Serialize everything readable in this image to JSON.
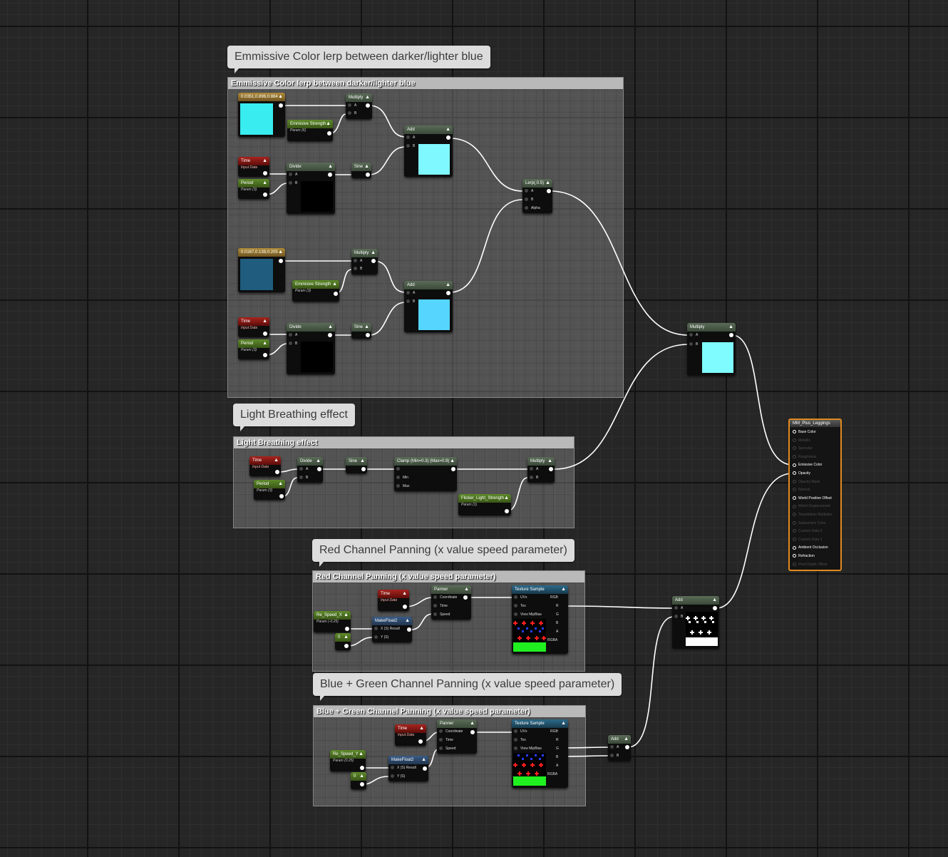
{
  "comments": {
    "emissive": {
      "bubble": "Emmissive Color lerp between darker/lighter blue",
      "title": "Emmissive Color lerp between darker/lighter blue"
    },
    "breathing": {
      "bubble": "Light Breathing effect",
      "title": "Light Breathing effect"
    },
    "red_pan": {
      "bubble": "Red Channel Panning (x value speed parameter)",
      "title": "Red Channel Panning (x value speed parameter)"
    },
    "bg_pan": {
      "bubble": "Blue + Green Channel Panning (x value speed parameter)",
      "title": "Blue + Green Channel Panning (x value speed parameter)"
    }
  },
  "nodes": {
    "const_light": {
      "title": "0.0351,0.896,0.884",
      "color": "#38ecf0"
    },
    "emissive_strength_1": {
      "title": "Emmisive Strength",
      "sub": "Param (6)"
    },
    "multiply_1": {
      "title": "Multiply",
      "a": "A",
      "b": "B"
    },
    "add_1": {
      "title": "Add",
      "a": "A",
      "b": "B",
      "color": "#7ff8ff"
    },
    "time_1": {
      "title": "Time",
      "sub": "Input Data"
    },
    "period_1": {
      "title": "Period",
      "sub": "Param (3)"
    },
    "divide_1": {
      "title": "Divide",
      "a": "A",
      "b": "B"
    },
    "sine_1": {
      "title": "Sine"
    },
    "lerp": {
      "title": "Lerp(,0.5)",
      "a": "A",
      "b": "B",
      "alpha": "Alpha"
    },
    "const_dark": {
      "title": "0.0167,0.138,0.205",
      "color": "#1f5c7e"
    },
    "multiply_2": {
      "title": "Multiply",
      "a": "A",
      "b": "B"
    },
    "emissive_strength_2": {
      "title": "Emmisive Strength",
      "sub": "Param (3)"
    },
    "add_2": {
      "title": "Add",
      "a": "A",
      "b": "B",
      "color": "#56d6ff"
    },
    "time_2": {
      "title": "Time",
      "sub": "Input Data"
    },
    "period_2": {
      "title": "Period",
      "sub": "Param (3)"
    },
    "divide_2": {
      "title": "Divide",
      "a": "A",
      "b": "B"
    },
    "sine_2": {
      "title": "Sine"
    },
    "multiply_main": {
      "title": "Multiply",
      "a": "A",
      "b": "B",
      "color": "#7ffcff"
    },
    "time_3": {
      "title": "Time",
      "sub": "Input Data"
    },
    "period_3": {
      "title": "Period",
      "sub": "Param (3)"
    },
    "divide_3": {
      "title": "Divide",
      "a": "A",
      "b": "B"
    },
    "sine_3": {
      "title": "Sine"
    },
    "clamp": {
      "title": "Clamp (Min=0.3) (Max=0.9)",
      "min": "Min",
      "max": "Max"
    },
    "multiply_3": {
      "title": "Multiply",
      "a": "A",
      "b": "B"
    },
    "flicker": {
      "title": "Flicker_Light_Strength",
      "sub": "Param (1)"
    },
    "time_4": {
      "title": "Time",
      "sub": "Input Data"
    },
    "panner_1": {
      "title": "Panner",
      "coord": "Coordinate",
      "time": "Time",
      "speed": "Speed"
    },
    "tex_1": {
      "title": "Texture Sample",
      "uvs": "UVs",
      "tex": "Tex",
      "mip": "View MipBias",
      "rgb": "RGB",
      "r": "R",
      "g": "G",
      "b": "B",
      "a": "A",
      "rgba": "RGBA"
    },
    "re_speed_x": {
      "title": "Re_Speed_X",
      "sub": "Param (-0.25)"
    },
    "zero_1": {
      "title": "0"
    },
    "makefloat_1": {
      "title": "MakeFloat2",
      "x": "X (S) Result",
      "y": "Y (S)"
    },
    "add_3": {
      "title": "Add",
      "a": "A",
      "b": "B"
    },
    "time_5": {
      "title": "Time",
      "sub": "Input Data"
    },
    "panner_2": {
      "title": "Panner",
      "coord": "Coordinate",
      "time": "Time",
      "speed": "Speed"
    },
    "tex_2": {
      "title": "Texture Sample",
      "uvs": "UVs",
      "tex": "Tex",
      "mip": "View MipBias",
      "rgb": "RGB",
      "r": "R",
      "g": "G",
      "b": "B",
      "a": "A",
      "rgba": "RGBA"
    },
    "re_speed_y": {
      "title": "Re_Speed_Y",
      "sub": "Param (0.25)"
    },
    "zero_2": {
      "title": "0"
    },
    "makefloat_2": {
      "title": "MakeFloat2",
      "x": "X (S) Result",
      "y": "Y (S)"
    },
    "add_4": {
      "title": "Add",
      "a": "A",
      "b": "B"
    }
  },
  "result": {
    "title": "MM_Plus_Leggings",
    "pins": [
      {
        "label": "Base Color",
        "active": true
      },
      {
        "label": "Metallic",
        "active": false
      },
      {
        "label": "Specular",
        "active": false
      },
      {
        "label": "Roughness",
        "active": false
      },
      {
        "label": "Emissive Color",
        "active": true
      },
      {
        "label": "Opacity",
        "active": true
      },
      {
        "label": "Opacity Mask",
        "active": false
      },
      {
        "label": "Normal",
        "active": false
      },
      {
        "label": "World Position Offset",
        "active": true
      },
      {
        "label": "World Displacement",
        "active": false
      },
      {
        "label": "Tessellation Multiplier",
        "active": false
      },
      {
        "label": "Subsurface Color",
        "active": false
      },
      {
        "label": "Custom Data 0",
        "active": false
      },
      {
        "label": "Custom Data 1",
        "active": false
      },
      {
        "label": "Ambient Occlusion",
        "active": true
      },
      {
        "label": "Refraction",
        "active": true
      },
      {
        "label": "Pixel Depth Offset",
        "active": false
      }
    ]
  },
  "colors": {
    "result_border": "#e08a1e",
    "wire": "#ffffff"
  }
}
